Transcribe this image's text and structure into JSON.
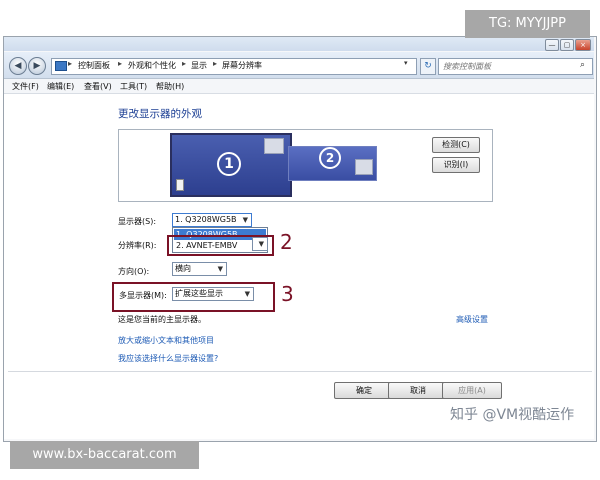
{
  "overlay": {
    "tag": "TG: MYYJJPP",
    "site": "www.bx-baccarat.com",
    "watermark": "知乎 @VM视酷运作"
  },
  "window_buttons": {
    "minimize": "—",
    "maximize": "▢",
    "close": "×"
  },
  "nav": {
    "back_icon": "◀",
    "forward_icon": "▶",
    "breadcrumbs": [
      "控制面板",
      "外观和个性化",
      "显示",
      "屏幕分辨率"
    ],
    "crumb_separator": "▸",
    "search_placeholder": "搜索控制面板",
    "refresh_icon": "↻",
    "dropdown_icon": "▾",
    "search_icon": "⌕"
  },
  "menu": [
    "文件(F)",
    "编辑(E)",
    "查看(V)",
    "工具(T)",
    "帮助(H)"
  ],
  "main": {
    "heading": "更改显示器的外观",
    "monitors": [
      "1",
      "2"
    ],
    "detect_label": "检测(C)",
    "identify_label": "识别(I)",
    "display_label": "显示器(S):",
    "display_value": "1. Q3208WG5B",
    "display_options": [
      "1. Q3208WG5B",
      "2. AVNET-EMBV"
    ],
    "resolution_label": "分辨率(R):",
    "orientation_label": "方向(O):",
    "orientation_value": "横向",
    "multi_label": "多显示器(M):",
    "multi_value": "扩展这些显示",
    "primary_note": "这是您当前的主显示器。",
    "advanced_link": "高级设置",
    "link1": "放大或缩小文本和其他项目",
    "link2": "我应该选择什么显示器设置?"
  },
  "annotations": [
    "2",
    "3"
  ],
  "buttons": {
    "ok": "确定",
    "cancel": "取消",
    "apply": "应用(A)"
  },
  "colors": {
    "annotation": "#7a1226",
    "link": "#1e5bb5",
    "heading": "#1c3f94",
    "dropdown_selected": "#3d7bd1"
  }
}
